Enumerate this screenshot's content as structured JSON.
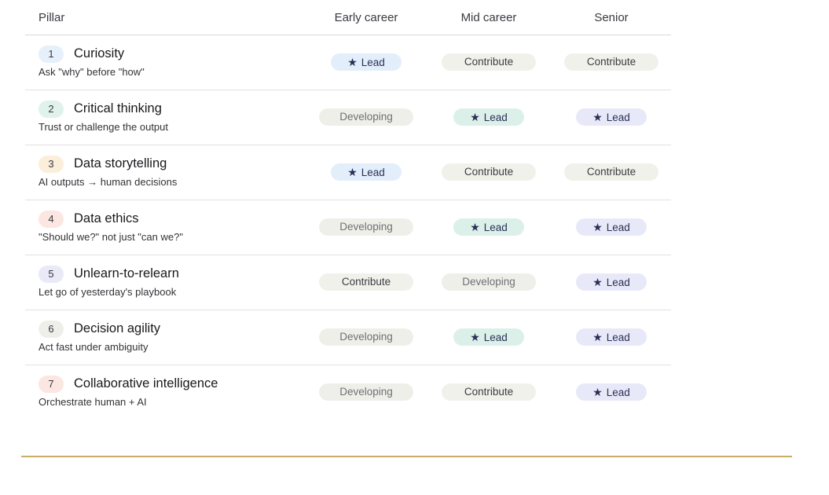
{
  "headers": {
    "pillar": "Pillar",
    "early": "Early career",
    "mid": "Mid career",
    "senior": "Senior"
  },
  "colors": {
    "lead_early": "#e3eefb",
    "lead_mid": "#dcf0ea",
    "lead_senior": "#e8e9f8",
    "contribute": "#f1f1ec",
    "developing": "#efefea",
    "rule": "#c9ad6a"
  },
  "rows": [
    {
      "num": "1",
      "num_color": "#e6f0fb",
      "title": "Curiosity",
      "subtitle": "Ask \"why\" before \"how\"",
      "early": {
        "label": "Lead",
        "level": "lead"
      },
      "mid": {
        "label": "Contribute",
        "level": "contribute"
      },
      "senior": {
        "label": "Contribute",
        "level": "contribute"
      }
    },
    {
      "num": "2",
      "num_color": "#e0f2ec",
      "title": "Critical thinking",
      "subtitle": "Trust or challenge the output",
      "early": {
        "label": "Developing",
        "level": "developing"
      },
      "mid": {
        "label": "Lead",
        "level": "lead"
      },
      "senior": {
        "label": "Lead",
        "level": "lead"
      }
    },
    {
      "num": "3",
      "num_color": "#fbeedb",
      "title": "Data storytelling",
      "subtitle": "AI outputs → human decisions",
      "early": {
        "label": "Lead",
        "level": "lead"
      },
      "mid": {
        "label": "Contribute",
        "level": "contribute"
      },
      "senior": {
        "label": "Contribute",
        "level": "contribute"
      }
    },
    {
      "num": "4",
      "num_color": "#fbe6e2",
      "title": "Data ethics",
      "subtitle": "\"Should we?\" not just \"can we?\"",
      "early": {
        "label": "Developing",
        "level": "developing"
      },
      "mid": {
        "label": "Lead",
        "level": "lead"
      },
      "senior": {
        "label": "Lead",
        "level": "lead"
      }
    },
    {
      "num": "5",
      "num_color": "#e9e9f8",
      "title": "Unlearn-to-relearn",
      "subtitle": "Let go of yesterday's playbook",
      "early": {
        "label": "Contribute",
        "level": "contribute"
      },
      "mid": {
        "label": "Developing",
        "level": "developing"
      },
      "senior": {
        "label": "Lead",
        "level": "lead"
      }
    },
    {
      "num": "6",
      "num_color": "#efefea",
      "title": "Decision agility",
      "subtitle": "Act fast under ambiguity",
      "early": {
        "label": "Developing",
        "level": "developing"
      },
      "mid": {
        "label": "Lead",
        "level": "lead"
      },
      "senior": {
        "label": "Lead",
        "level": "lead"
      }
    },
    {
      "num": "7",
      "num_color": "#fbe6e2",
      "title": "Collaborative intelligence",
      "subtitle": "Orchestrate human + AI",
      "early": {
        "label": "Developing",
        "level": "developing"
      },
      "mid": {
        "label": "Contribute",
        "level": "contribute"
      },
      "senior": {
        "label": "Lead",
        "level": "lead"
      }
    }
  ]
}
